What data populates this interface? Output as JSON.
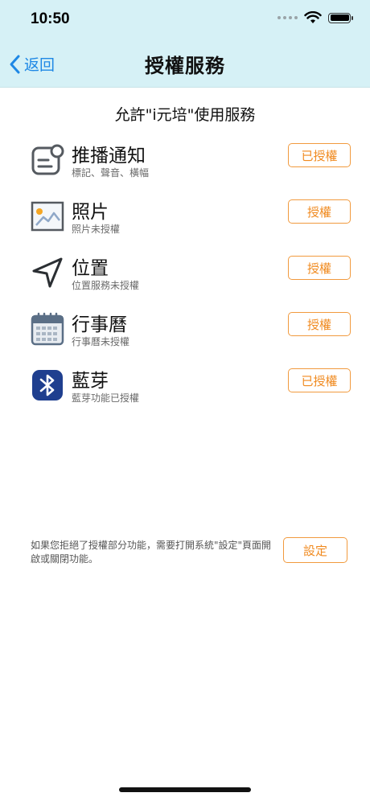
{
  "status": {
    "time": "10:50"
  },
  "nav": {
    "back_label": "返回",
    "title": "授權服務"
  },
  "intro": "允許\"i元培\"使用服務",
  "services": [
    {
      "title": "推播通知",
      "subtitle": "標記、聲音、橫幅",
      "button": "已授權",
      "icon": "notification-icon"
    },
    {
      "title": "照片",
      "subtitle": "照片未授權",
      "button": "授權",
      "icon": "photo-icon"
    },
    {
      "title": "位置",
      "subtitle": "位置服務未授權",
      "button": "授權",
      "icon": "location-arrow-icon"
    },
    {
      "title": "行事曆",
      "subtitle": "行事曆未授權",
      "button": "授權",
      "icon": "calendar-icon"
    },
    {
      "title": "藍芽",
      "subtitle": "藍芽功能已授權",
      "button": "已授權",
      "icon": "bluetooth-icon"
    }
  ],
  "settings": {
    "note": "如果您拒絕了授權部分功能，需要打開系統\"設定\"頁面開啟或關閉功能。",
    "button": "設定"
  },
  "colors": {
    "header_bg": "#d6f1f6",
    "accent": "#f08a1f",
    "link": "#1e88e5"
  }
}
